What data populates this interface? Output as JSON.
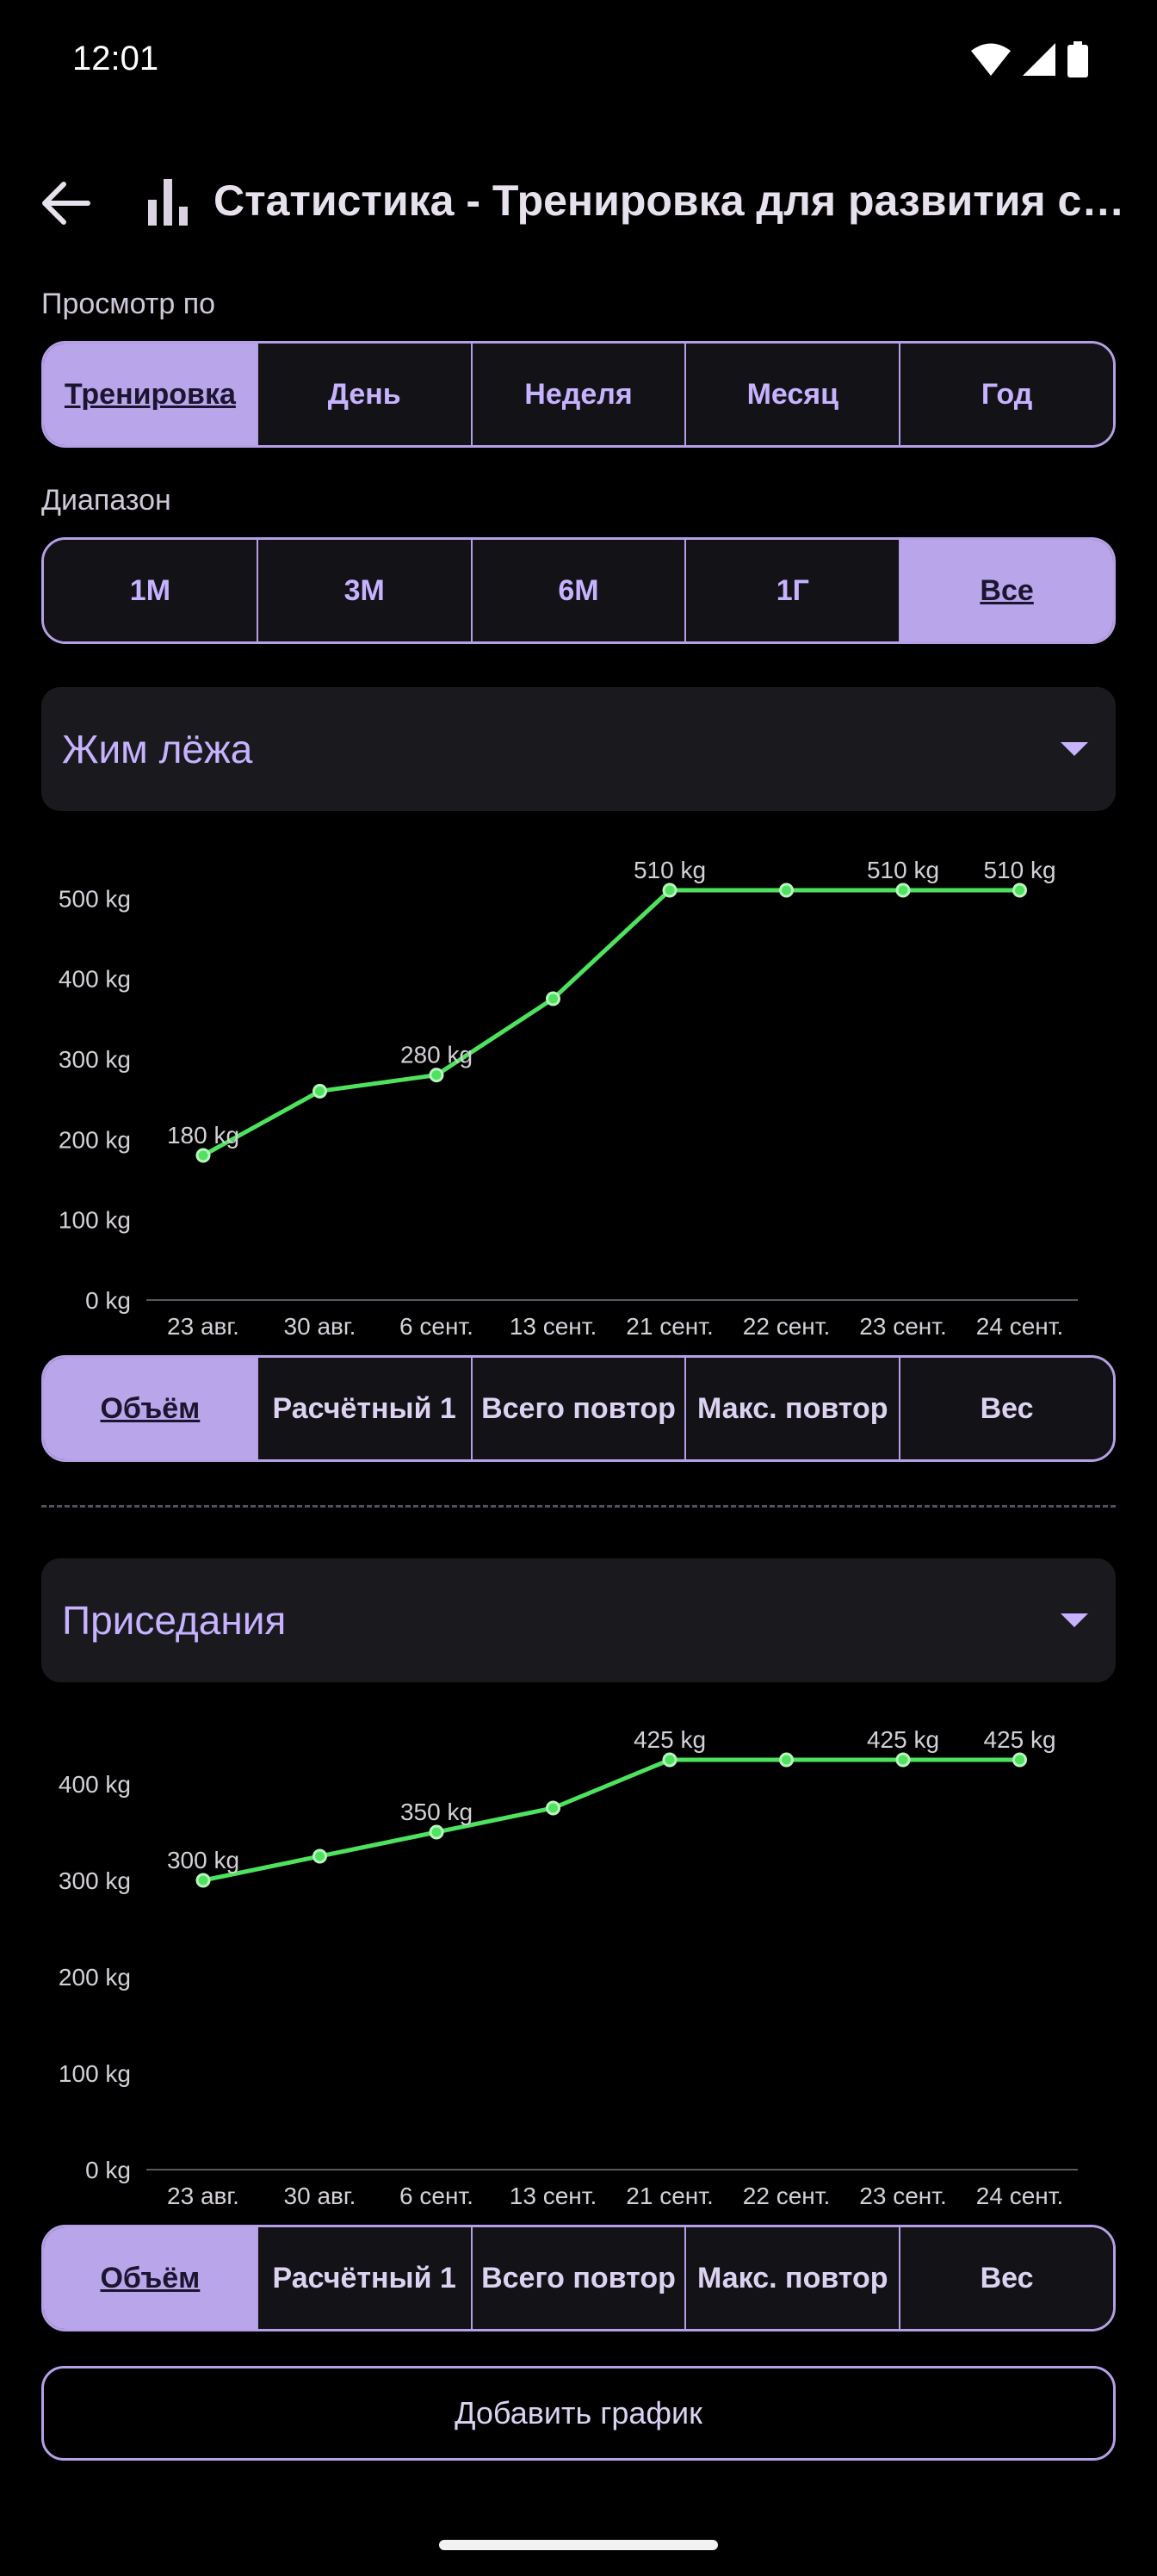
{
  "status_bar": {
    "time": "12:01"
  },
  "app_bar": {
    "title": "Статистика - Тренировка для развития силы"
  },
  "view_by": {
    "label": "Просмотр по",
    "options": [
      "Тренировка",
      "День",
      "Неделя",
      "Месяц",
      "Год"
    ],
    "selected": 0
  },
  "range": {
    "label": "Диапазон",
    "options": [
      "1М",
      "3М",
      "6М",
      "1Г",
      "Все"
    ],
    "selected": 4
  },
  "metric_options": [
    "Объём",
    "Расчётный 1",
    "Всего повтор",
    "Макс. повтор",
    "Вес"
  ],
  "chart_data": [
    {
      "type": "line",
      "exercise": "Жим лёжа",
      "categories": [
        "23 авг.",
        "30 авг.",
        "6 сент.",
        "13 сент.",
        "21 сент.",
        "22 сент.",
        "23 сент.",
        "24 сент."
      ],
      "values": [
        180,
        260,
        280,
        375,
        510,
        510,
        510,
        510
      ],
      "point_labels": [
        "180 kg",
        "",
        "280 kg",
        "",
        "510 kg",
        "",
        "510 kg",
        "510 kg"
      ],
      "yticks": [
        0,
        100,
        200,
        300,
        400,
        500
      ],
      "ytick_labels": [
        "0 kg",
        "100 kg",
        "200 kg",
        "300 kg",
        "400 kg",
        "500 kg"
      ],
      "ylim": [
        0,
        510
      ],
      "color": "#4ee25e",
      "selected_metric": 0
    },
    {
      "type": "line",
      "exercise": "Приседания",
      "categories": [
        "23 авг.",
        "30 авг.",
        "6 сент.",
        "13 сент.",
        "21 сент.",
        "22 сент.",
        "23 сент.",
        "24 сент."
      ],
      "values": [
        300,
        325,
        350,
        375,
        425,
        425,
        425,
        425
      ],
      "point_labels": [
        "300 kg",
        "",
        "350 kg",
        "",
        "425 kg",
        "",
        "425 kg",
        "425 kg"
      ],
      "yticks": [
        0,
        100,
        200,
        300,
        400
      ],
      "ytick_labels": [
        "0 kg",
        "100 kg",
        "200 kg",
        "300 kg",
        "400 kg"
      ],
      "ylim": [
        0,
        425
      ],
      "color": "#4ee25e",
      "selected_metric": 0
    }
  ],
  "add_chart_label": "Добавить график",
  "colors": {
    "accent": "#b9a6ea",
    "line": "#4ee25e",
    "background": "#000000"
  }
}
